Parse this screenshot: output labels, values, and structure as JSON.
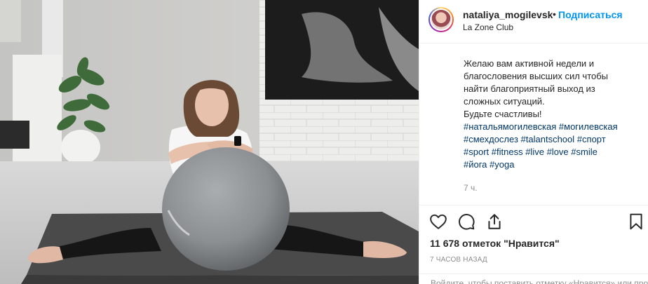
{
  "post": {
    "username": "nataliya_mogilevsk",
    "dot": "•",
    "follow_label": "Подписаться",
    "location": "La Zone Club",
    "caption_lines": [
      "Желаю вам активной недели и",
      "благословения высших сил чтобы",
      "найти благоприятный выход из",
      "сложных ситуаций.",
      "Будьте счастливы!"
    ],
    "hashtags": [
      [
        "#натальямогилевская",
        "#могилевская"
      ],
      [
        "#смехдослез",
        "#talantschool",
        "#спорт"
      ],
      [
        "#sport",
        "#fitness",
        "#live",
        "#love",
        "#smile"
      ],
      [
        "#йога",
        "#yoga"
      ]
    ],
    "age": "7 ч.",
    "likes": "11 678 отметок \"Нравится\"",
    "timestamp": "7 часов назад",
    "comment_prompt": "Войдите, чтобы поставить отметку «Нравится» или прокомментировать."
  },
  "colors": {
    "link": "#0095f6",
    "hashtag": "#00376b",
    "muted": "#8e8e8e",
    "text": "#262626"
  },
  "icons": {
    "like": "heart-icon",
    "comment": "comment-icon",
    "share": "share-icon",
    "save": "bookmark-icon"
  }
}
